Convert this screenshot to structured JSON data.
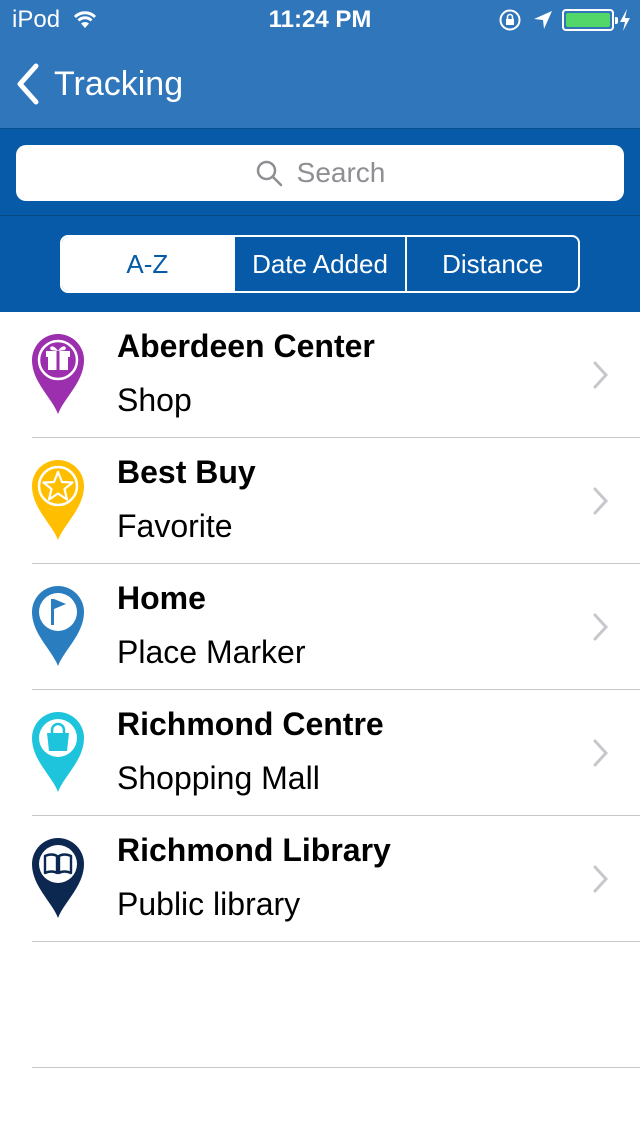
{
  "status_bar": {
    "carrier": "iPod",
    "time": "11:24 PM",
    "battery_color": "#53d769"
  },
  "nav": {
    "back_label": "Tracking"
  },
  "search": {
    "placeholder": "Search"
  },
  "sort": {
    "options": [
      "A-Z",
      "Date Added",
      "Distance"
    ],
    "selected": "A-Z"
  },
  "places": [
    {
      "name": "Aberdeen Center",
      "category": "Shop",
      "icon": "gift-pin-icon",
      "color": "#9b2fae"
    },
    {
      "name": "Best Buy",
      "category": "Favorite",
      "icon": "star-pin-icon",
      "color": "#ffbe00"
    },
    {
      "name": "Home",
      "category": "Place Marker",
      "icon": "flag-pin-icon",
      "color": "#2a7ec0"
    },
    {
      "name": "Richmond Centre",
      "category": "Shopping Mall",
      "icon": "shopping-bag-pin-icon",
      "color": "#1ec4dc"
    },
    {
      "name": "Richmond Library",
      "category": "Public library",
      "icon": "book-pin-icon",
      "color": "#0d2850"
    }
  ],
  "colors": {
    "nav_bar": "#2f76bb",
    "search_bar": "#065aa8"
  }
}
